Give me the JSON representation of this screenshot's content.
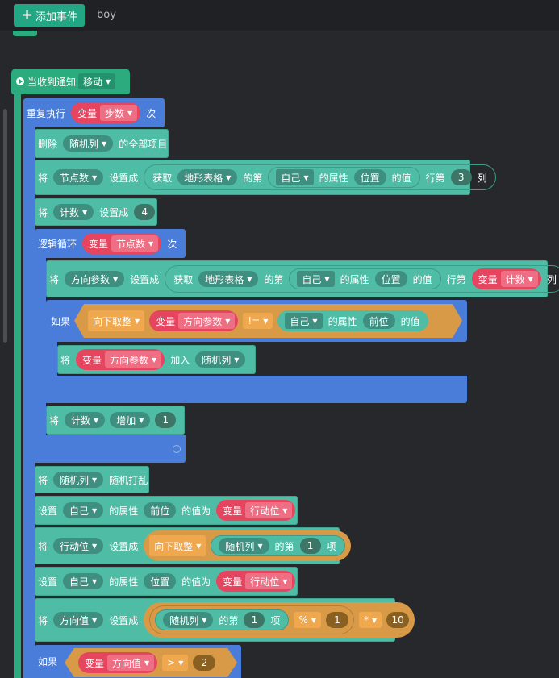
{
  "toolbar": {
    "add_event_label": "添加事件",
    "sprite_name": "boy"
  },
  "blocks": {
    "event": {
      "label": "当收到通知",
      "message": "移动"
    },
    "repeat": {
      "label": "重复执行",
      "var_label": "变量",
      "var_name": "步数",
      "suffix": "次"
    },
    "delete_all": {
      "prefix": "删除",
      "list": "随机列",
      "suffix": "的全部项目"
    },
    "set_node": {
      "prefix": "将",
      "var": "节点数",
      "set": "设置成",
      "get": "获取",
      "table": "地形表格",
      "of_item": "的第",
      "self": "自己",
      "attr_of": "的属性",
      "attr": "位置",
      "value_of": "的值",
      "row": "行第",
      "col_num": "3",
      "col": "列"
    },
    "set_count": {
      "prefix": "将",
      "var": "计数",
      "set": "设置成",
      "value": "4"
    },
    "logic_loop": {
      "label": "逻辑循环",
      "var_label": "变量",
      "var_name": "节点数",
      "suffix": "次"
    },
    "set_dir": {
      "prefix": "将",
      "var": "方向参数",
      "set": "设置成",
      "get": "获取",
      "table": "地形表格",
      "of_item": "的第",
      "self": "自己",
      "attr_of": "的属性",
      "attr": "位置",
      "value_of": "的值",
      "row": "行第",
      "var_label": "变量",
      "var_name": "计数",
      "col": "列"
    },
    "if1": {
      "label": "如果",
      "floor": "向下取整",
      "var_label": "变量",
      "var_name": "方向参数",
      "op": "!=",
      "self": "自己",
      "attr_of": "的属性",
      "attr": "前位",
      "value_of": "的值"
    },
    "add_to_list": {
      "prefix": "将",
      "var_label": "变量",
      "var_name": "方向参数",
      "join": "加入",
      "list": "随机列"
    },
    "inc_count": {
      "prefix": "将",
      "var": "计数",
      "op": "增加",
      "value": "1"
    },
    "shuffle": {
      "prefix": "将",
      "list": "随机列",
      "suffix": "随机打乱"
    },
    "set_front": {
      "prefix": "设置",
      "self": "自己",
      "attr_of": "的属性",
      "attr": "前位",
      "value_of": "的值为",
      "var_label": "变量",
      "var_name": "行动位"
    },
    "set_action": {
      "prefix": "将",
      "var": "行动位",
      "set": "设置成",
      "floor": "向下取整",
      "list": "随机列",
      "of_item": "的第",
      "index": "1",
      "item": "项"
    },
    "set_pos": {
      "prefix": "设置",
      "self": "自己",
      "attr_of": "的属性",
      "attr": "位置",
      "value_of": "的值为",
      "var_label": "变量",
      "var_name": "行动位"
    },
    "set_dirval": {
      "prefix": "将",
      "var": "方向值",
      "set": "设置成",
      "list": "随机列",
      "of_item": "的第",
      "index": "1",
      "item": "项",
      "mod": "%",
      "mod_val": "1",
      "mul": "*",
      "mul_val": "10"
    },
    "if2": {
      "label": "如果",
      "var_label": "变量",
      "var_name": "方向值",
      "op": ">",
      "value": "2"
    }
  },
  "colors": {
    "background": "#26282c",
    "green_block": "#4fbca5",
    "blue_block": "#4a7dd9",
    "event_block": "#2cab7f",
    "variable": "#e6455f",
    "operator": "#d99a48",
    "add_button": "#23a683"
  }
}
